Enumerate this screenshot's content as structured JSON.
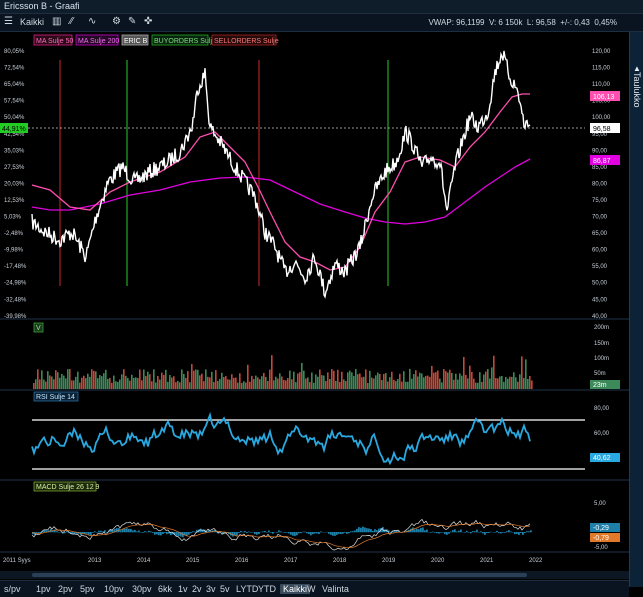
{
  "window": {
    "title": "Ericsson B - Graafi"
  },
  "toolbar": {
    "range_label": "Kaikki",
    "stats": {
      "vwap": "VWAP: 96,1199",
      "v": "V: 6 150k",
      "l": "L: 96,58",
      "change": "+/-: 0,43",
      "pct": "0,45%"
    }
  },
  "sidetab": {
    "label": "Taulukko"
  },
  "legend": {
    "ma50": "MA Sulje 50",
    "ma200": "MA Sulje 200",
    "eric": "ERIC B",
    "buy": "BUYORDERS Sulje",
    "sell": "SELLORDERS Sulje"
  },
  "price_axis": {
    "left_ticks": [
      "80,05%",
      "72,54%",
      "65,04%",
      "57,54%",
      "50,04%",
      "42,54%",
      "35,03%",
      "27,53%",
      "20,03%",
      "12,53%",
      "5,03%",
      "-2,48%",
      "-9,98%",
      "-17,48%",
      "-24,98%",
      "-32,48%",
      "-39,98%"
    ],
    "right_ticks": [
      "120,00",
      "115,00",
      "110,00",
      "105,00",
      "100,00",
      "95,00",
      "90,00",
      "85,00",
      "80,00",
      "75,00",
      "70,00",
      "65,00",
      "60,00",
      "55,00",
      "50,00",
      "45,00",
      "40,00"
    ],
    "current_pct": "44,91%",
    "last_price": "96,58",
    "ma50_value": "106,13",
    "ma200_value": "86,87"
  },
  "volume": {
    "label": "V",
    "ticks": [
      "200m",
      "150m",
      "100m",
      "50m"
    ],
    "current": "23m"
  },
  "rsi": {
    "label": "RSI Sulje 14",
    "ticks": [
      "80,00",
      "60,00",
      "40,00"
    ],
    "current": "40,62"
  },
  "macd": {
    "label": "MACD Sulje 26 12 9",
    "ticks": [
      "5,00",
      "-5,00"
    ],
    "value1": "-0,29",
    "value2": "-0,79"
  },
  "time_axis": {
    "start_label": "2011 Syys",
    "years": [
      "2013",
      "2014",
      "2015",
      "2016",
      "2017",
      "2018",
      "2019",
      "2020",
      "2021",
      "2022"
    ]
  },
  "bottombar": {
    "items": [
      "1pv",
      "2pv",
      "5pv",
      "10pv",
      "30pv",
      "6kk",
      "1v",
      "2v",
      "3v",
      "5v",
      "LYTD",
      "YTD",
      "Kaikki",
      "W",
      "Valinta"
    ],
    "first_label": "s/pv",
    "active": "Kaikki"
  },
  "colors": {
    "price": "#ffffff",
    "ma50": "#ff4fb0",
    "ma200": "#e000e0",
    "buy": "#22aa22",
    "sell": "#aa2222",
    "rsi": "#2aa8e0",
    "vol_up": "#3c8a5a",
    "vol_down": "#c24a3a"
  }
}
